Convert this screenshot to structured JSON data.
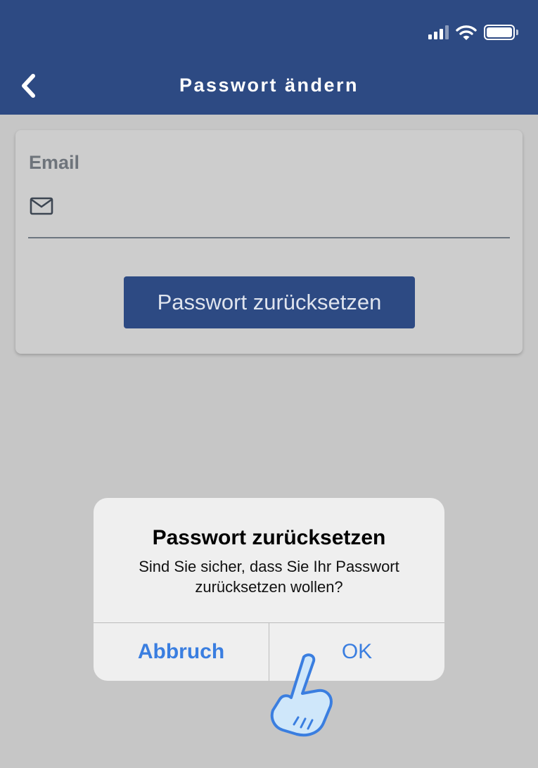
{
  "status_bar": {
    "icons": [
      "signal-icon",
      "wifi-icon",
      "battery-icon"
    ]
  },
  "header": {
    "title": "Passwort ändern",
    "back_icon": "chevron-left-icon",
    "background": "#2d4a83"
  },
  "form": {
    "email_label": "Email",
    "email_icon": "mail-icon",
    "email_value": "",
    "reset_button_label": "Passwort zurücksetzen"
  },
  "alert": {
    "title": "Passwort zurücksetzen",
    "message": "Sind Sie sicher, dass Sie Ihr Passwort zurücksetzen wollen?",
    "cancel_label": "Abbruch",
    "ok_label": "OK",
    "button_color": "#3a7ee0"
  },
  "pointer": {
    "icon": "tap-hand-icon",
    "target": "OK"
  }
}
